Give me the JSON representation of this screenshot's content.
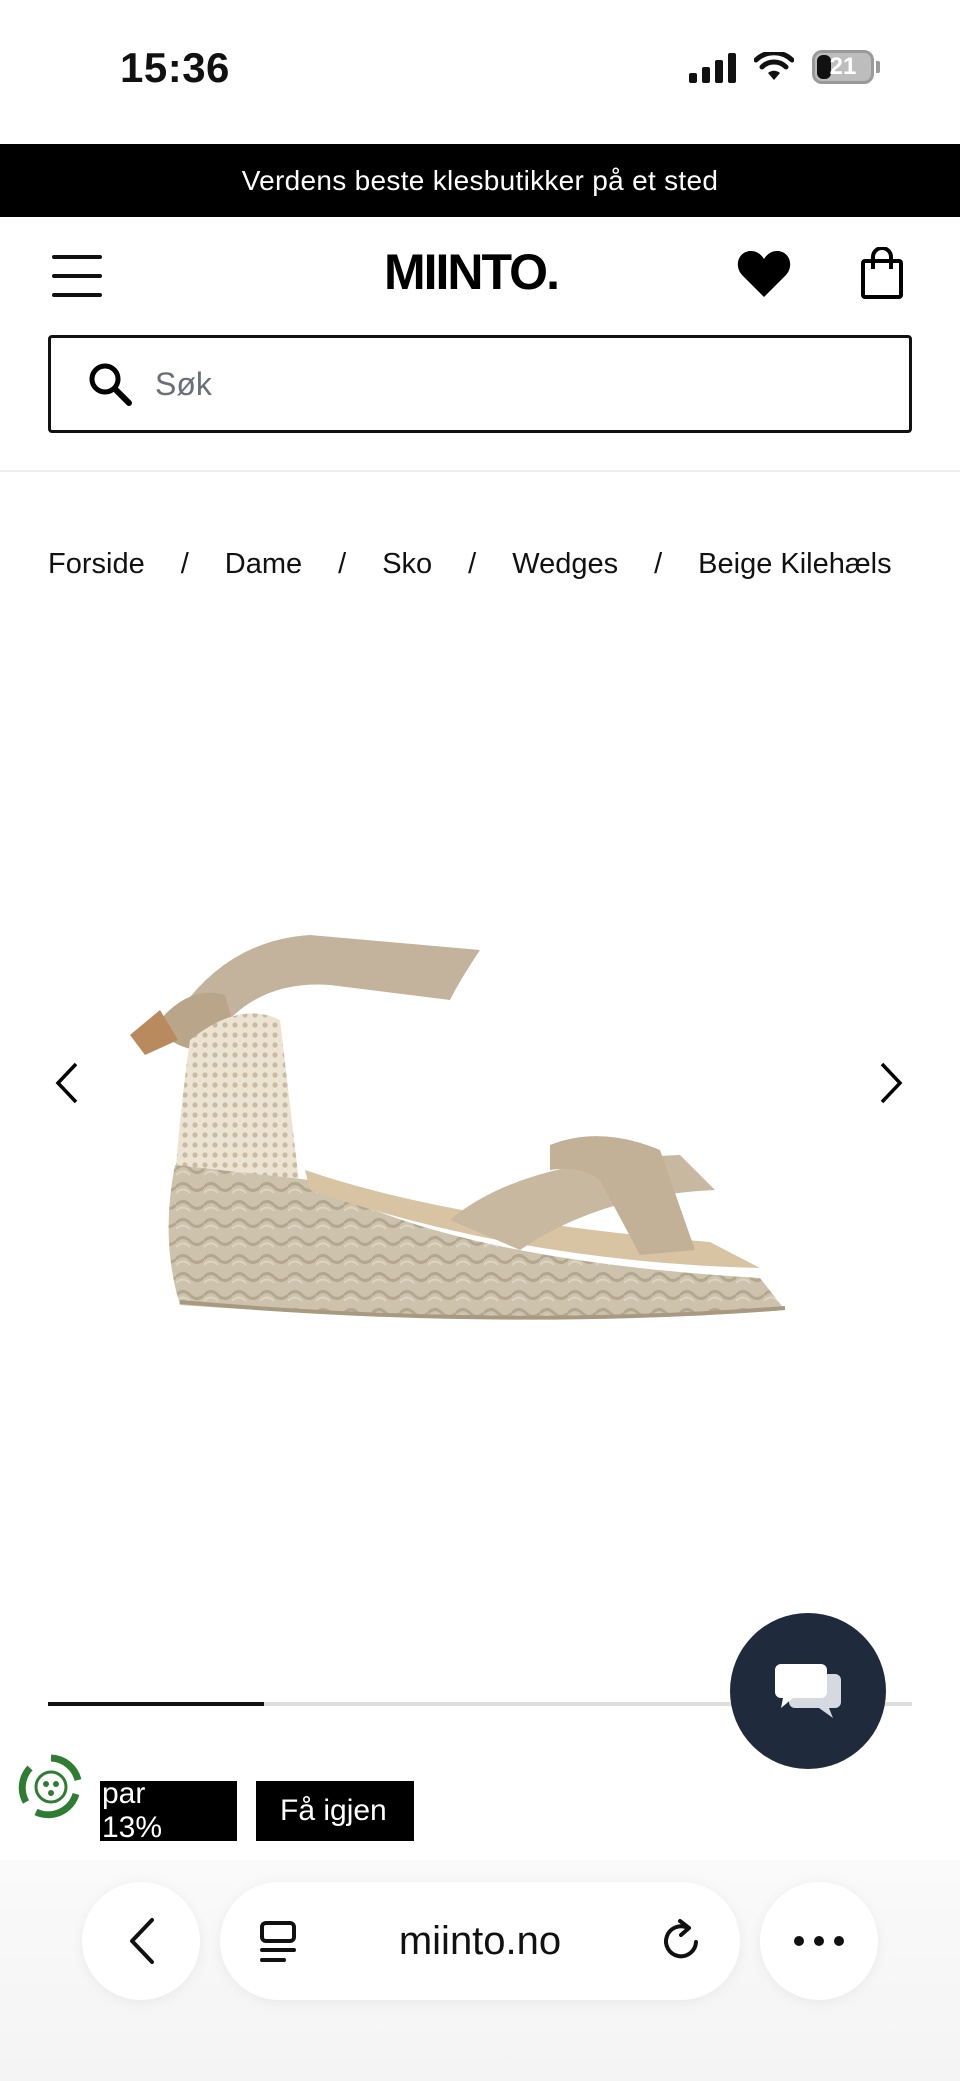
{
  "status_bar": {
    "time": "15:36",
    "battery": "21"
  },
  "promo": {
    "text": "Verdens beste klesbutikker på et sted"
  },
  "header": {
    "logo": "MIINTO."
  },
  "search": {
    "placeholder": "Søk"
  },
  "breadcrumb": {
    "items": [
      "Forside",
      "Dame",
      "Sko",
      "Wedges",
      "Beige Kilehæls"
    ],
    "separator": "/"
  },
  "gallery": {
    "progress": 0.25
  },
  "tags": {
    "save": "par 13%",
    "again": "Få igjen"
  },
  "browser": {
    "url": "miinto.no"
  },
  "colors": {
    "chat_bg": "#1f2a3c",
    "eco_green": "#2e7d32",
    "promo_bg": "#000000"
  },
  "icons": [
    "menu-icon",
    "heart-icon",
    "bag-icon",
    "search-icon",
    "chevron-left-icon",
    "chevron-right-icon",
    "chat-icon",
    "eco-icon",
    "tabs-icon",
    "reload-icon",
    "more-icon"
  ]
}
